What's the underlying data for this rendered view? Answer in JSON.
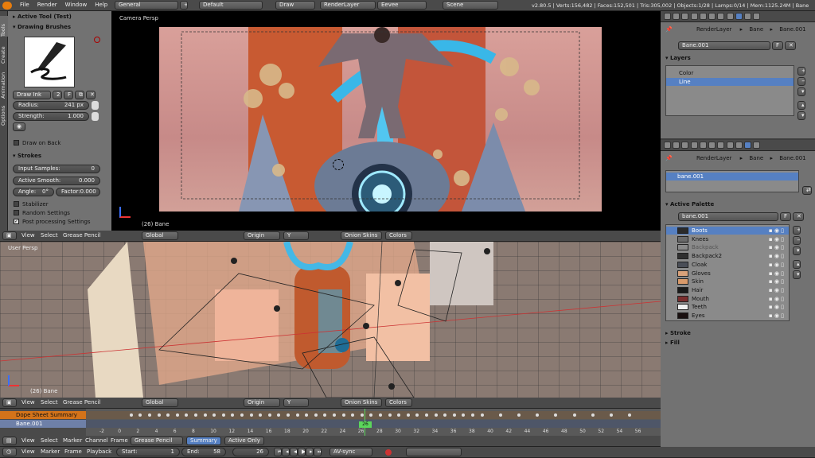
{
  "topbar": {
    "menus": [
      "File",
      "Render",
      "Window",
      "Help"
    ],
    "workspace": "General",
    "layout": "Default",
    "mode": "Draw",
    "renderlayer": "RenderLayer",
    "engine": "Eevee",
    "scene": "Scene",
    "stats": "v2.80.5 | Verts:156,482 | Faces:152,501 | Tris:305,002 | Objects:1/28 | Lamps:0/14 | Mem:1125.24M | Bane"
  },
  "tool_panel": {
    "vtabs": [
      "Tools",
      "Create",
      "Animation",
      "Options"
    ],
    "active_tool": "Active Tool (Test)",
    "drawing_brushes": "Drawing Brushes",
    "brush_name": "Draw Ink",
    "brush_users": "2",
    "brush_fake": "F",
    "radius_label": "Radius:",
    "radius_value": "241 px",
    "strength_label": "Strength:",
    "strength_value": "1.000",
    "draw_on_back": "Draw on Back",
    "strokes": "Strokes",
    "input_samples_label": "Input Samples:",
    "input_samples_value": "0",
    "active_smooth_label": "Active Smooth:",
    "active_smooth_value": "0.000",
    "angle_label": "Angle:",
    "angle_value": "0°",
    "factor_label": "Factor:",
    "factor_value": "0.000",
    "stabilizer": "Stabilizer",
    "random_settings": "Random Settings",
    "post_processing": "Post processing Settings"
  },
  "camera_view": {
    "label": "Camera Persp",
    "object_label": "(26) Bane"
  },
  "view3d_header": {
    "menus": [
      "View",
      "Select",
      "Grease Pencil"
    ],
    "orientation": "Global",
    "pivot": "Origin",
    "axis": "Y",
    "onion": "Onion Skins",
    "colors": "Colors"
  },
  "user_view": {
    "label": "User Persp",
    "object_label": "(26) Bane"
  },
  "dopesheet": {
    "summary": "Dope Sheet Summary",
    "object": "Bane.001",
    "current_frame": "26",
    "ticks": [
      "-2",
      "0",
      "2",
      "4",
      "6",
      "8",
      "10",
      "12",
      "14",
      "16",
      "18",
      "20",
      "22",
      "24",
      "26",
      "28",
      "30",
      "32",
      "34",
      "36",
      "38",
      "40",
      "42",
      "44",
      "46",
      "48",
      "50",
      "52",
      "54",
      "56"
    ],
    "header_menus": [
      "View",
      "Select",
      "Marker",
      "Channel",
      "Frame"
    ],
    "mode": "Grease Pencil",
    "summary_btn": "Summary",
    "active_only": "Active Only"
  },
  "timeline": {
    "menus": [
      "View",
      "Marker",
      "Frame",
      "Playback"
    ],
    "start_label": "Start:",
    "start_value": "1",
    "end_label": "End:",
    "end_value": "58",
    "frame_value": "26",
    "sync": "AV-sync"
  },
  "properties_top": {
    "breadcrumb": [
      "RenderLayer",
      "Bane",
      "Bane.001"
    ],
    "data_name": "Bane.001",
    "fake": "F",
    "layers_title": "Layers",
    "layers": [
      "Color",
      "Line"
    ]
  },
  "properties_bottom": {
    "breadcrumb": [
      "RenderLayer",
      "Bane",
      "Bane.001"
    ],
    "data_item": "bane.001",
    "palette_title": "Active Palette",
    "palette_name": "bane.001",
    "palette_fake": "F",
    "colors": [
      {
        "name": "Boots",
        "hex": "#2b2b2b"
      },
      {
        "name": "Knees",
        "hex": "#6b6b6b"
      },
      {
        "name": "Backpack",
        "hex": "#8a8a8a"
      },
      {
        "name": "Backpack2",
        "hex": "#2f2f2f"
      },
      {
        "name": "Cloak",
        "hex": "#4a4e57"
      },
      {
        "name": "Gloves",
        "hex": "#d9a27a"
      },
      {
        "name": "Skin",
        "hex": "#d99a6a"
      },
      {
        "name": "Hair",
        "hex": "#1a1a1a"
      },
      {
        "name": "Mouth",
        "hex": "#7a2e2e"
      },
      {
        "name": "Teeth",
        "hex": "#f0f0f0"
      },
      {
        "name": "Eyes",
        "hex": "#1a1010"
      }
    ],
    "stroke": "Stroke",
    "fill": "Fill"
  }
}
